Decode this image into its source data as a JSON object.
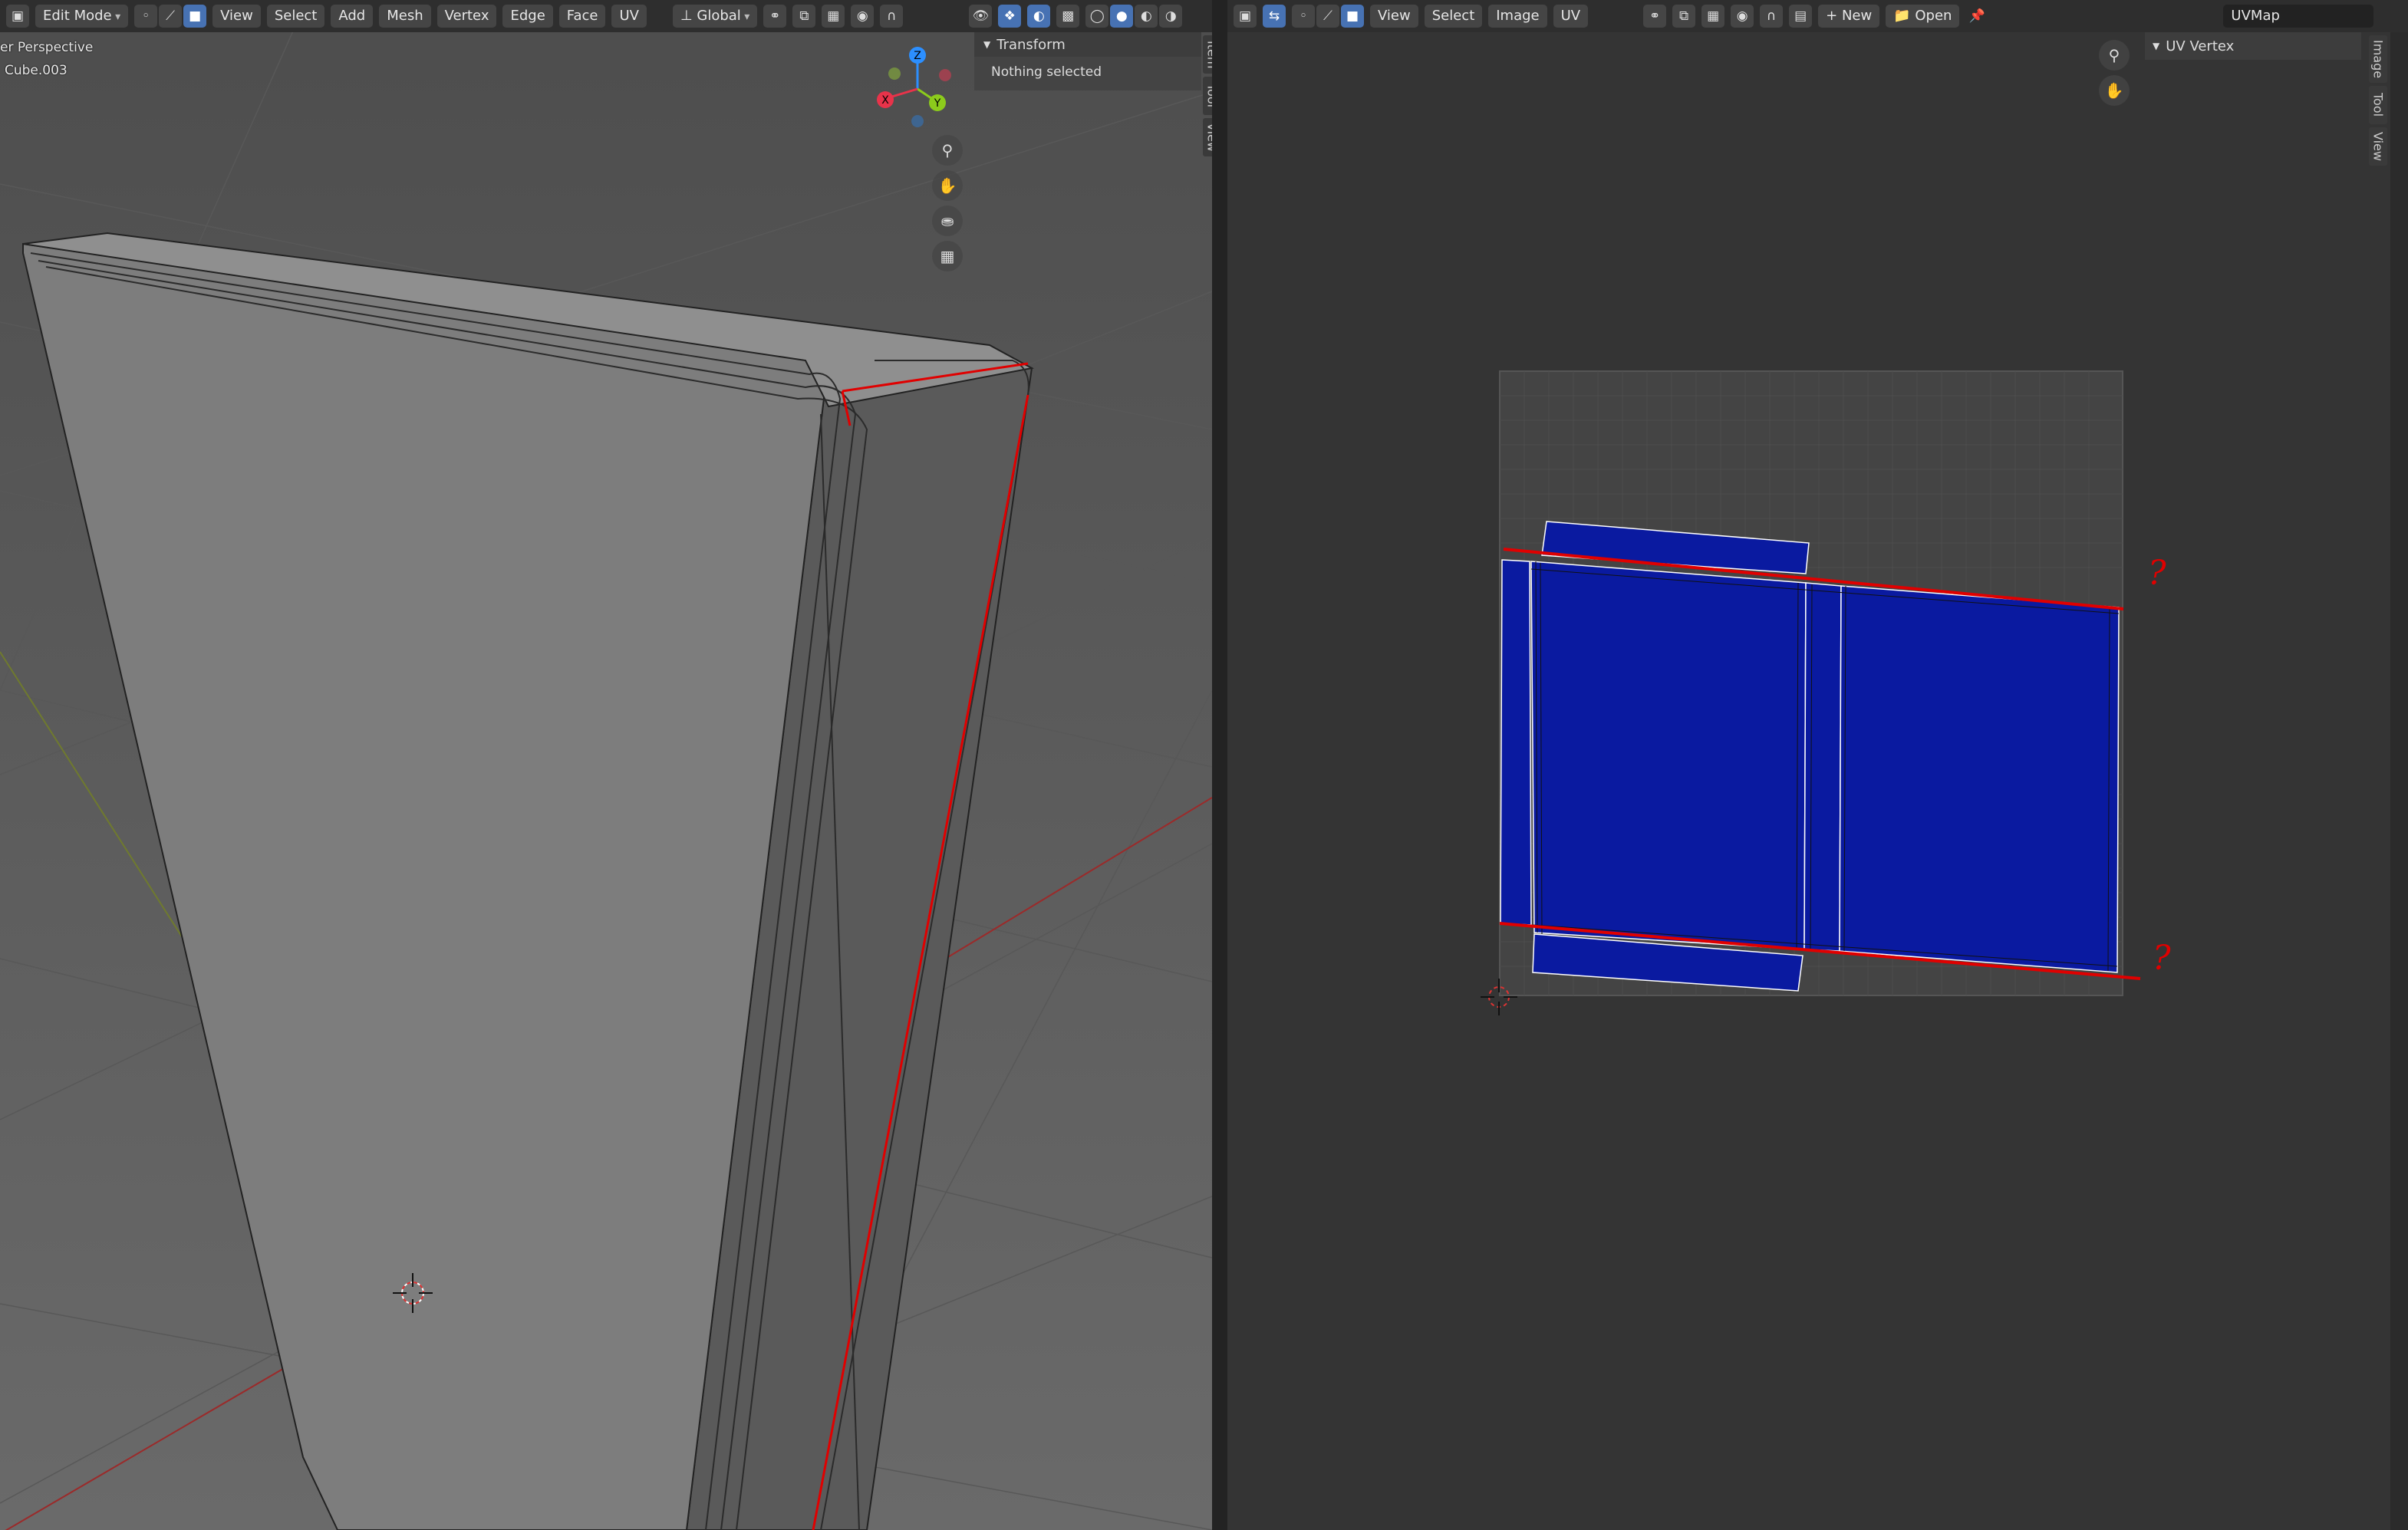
{
  "viewport3d": {
    "mode_label": "Edit Mode",
    "menu": [
      "View",
      "Select",
      "Add",
      "Mesh",
      "Vertex",
      "Edge",
      "Face",
      "UV"
    ],
    "orientation_label": "Global",
    "view_name": "er Perspective",
    "object_name": "Cube.003",
    "gizmo_axes": {
      "z": "Z",
      "y": "Y",
      "x": "X"
    },
    "side_tabs": [
      "Item",
      "Tool",
      "View"
    ],
    "npanel": {
      "header": "Transform",
      "message": "Nothing selected"
    },
    "nav_icons": [
      "zoom-icon",
      "pan-hand-icon",
      "camera-icon",
      "ortho-grid-icon"
    ]
  },
  "uv_editor": {
    "menu": [
      "View",
      "Select",
      "Image",
      "UV"
    ],
    "new_label": "New",
    "open_label": "Open",
    "uvmap_name": "UVMap",
    "panel_header": "UV Vertex",
    "side_tabs": [
      "Image",
      "Tool",
      "View"
    ],
    "annotation_marks": [
      "?",
      "?"
    ]
  },
  "colors": {
    "selection_red": "#e00000",
    "uv_face_blue": "#0a1aa0",
    "header_bg": "#2e2e2e",
    "active_blue": "#4772b3",
    "axis_x": "#e8334a",
    "axis_y": "#8ccb1c",
    "axis_z": "#2c8fff"
  }
}
